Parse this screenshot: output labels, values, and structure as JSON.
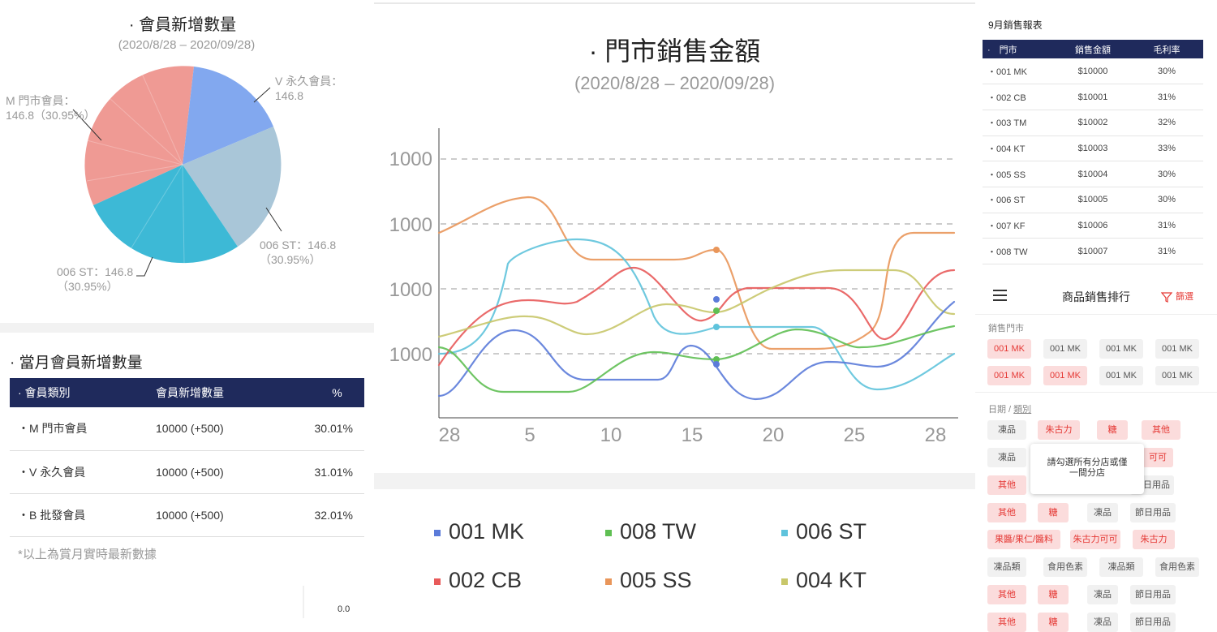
{
  "member_pie": {
    "title": "· 會員新增數量",
    "subtitle": "(2020/8/28 – 2020/09/28)",
    "labels": {
      "m": [
        "M 門市會員：",
        "146.8（30.95%）"
      ],
      "v": [
        "V 永久會員：",
        "146.8"
      ],
      "st1": [
        "006 ST：146.8",
        "（30.95%）"
      ],
      "st2": [
        "006 ST：146.8",
        "（30.95%）"
      ]
    },
    "colors": {
      "salmon": "#ef9a94",
      "blue": "#82a8ef",
      "grayblue": "#a9c6d8",
      "cyan": "#3db9d6"
    }
  },
  "monthly": {
    "title": "· 當月會員新增數量",
    "headers": [
      "· 會員類別",
      "會員新增數量",
      "%"
    ],
    "rows": [
      [
        "・M 門市會員",
        "10000 (+500)",
        "30.01%"
      ],
      [
        "・V 永久會員",
        "10000 (+500)",
        "31.01%"
      ],
      [
        "・B 批發會員",
        "10000 (+500)",
        "32.01%"
      ]
    ],
    "note": "*以上為賞月實時最新數據",
    "zero": "0.0"
  },
  "sales_chart": {
    "title": "· 門市銷售金額",
    "subtitle": "(2020/8/28 – 2020/09/28)",
    "y_tick_labels": [
      "1000",
      "1000",
      "1000",
      "1000"
    ],
    "x_tick_labels": [
      "28",
      "5",
      "10",
      "15",
      "20",
      "25",
      "28"
    ],
    "legend": [
      {
        "name": "001 MK",
        "color": "#5b7bd9"
      },
      {
        "name": "008 TW",
        "color": "#5fbf53"
      },
      {
        "name": "006 ST",
        "color": "#5fc3dc"
      },
      {
        "name": "002 CB",
        "color": "#e85a5a"
      },
      {
        "name": "005 SS",
        "color": "#e9965a"
      },
      {
        "name": "004 KT",
        "color": "#c8c76a"
      }
    ]
  },
  "sep_report": {
    "title": "9月銷售報表",
    "headers": [
      "·　門市",
      "銷售金額",
      "毛利率"
    ],
    "rows": [
      [
        "・001 MK",
        "$10000",
        "30%"
      ],
      [
        "・002 CB",
        "$10001",
        "31%"
      ],
      [
        "・003 TM",
        "$10002",
        "32%"
      ],
      [
        "・004 KT",
        "$10003",
        "33%"
      ],
      [
        "・005 SS",
        "$10004",
        "30%"
      ],
      [
        "・006 ST",
        "$10005",
        "30%"
      ],
      [
        "・007 KF",
        "$10006",
        "31%"
      ],
      [
        "・008 TW",
        "$10007",
        "31%"
      ]
    ]
  },
  "ranking": {
    "title": "商品銷售排行",
    "filter": "篩選",
    "store_label": "銷售門市",
    "store_chips": [
      {
        "t": "001 MK",
        "on": true
      },
      {
        "t": "001 MK",
        "on": false
      },
      {
        "t": "001 MK",
        "on": false
      },
      {
        "t": "001 MK",
        "on": false
      },
      {
        "t": "001 MK",
        "on": true
      },
      {
        "t": "001 MK",
        "on": true
      },
      {
        "t": "001 MK",
        "on": false
      },
      {
        "t": "001 MK",
        "on": false
      }
    ],
    "date_label": "日期 / ",
    "category_label": "類別",
    "cat_chips": [
      {
        "t": "凍品",
        "on": false
      },
      {
        "t": "朱古力",
        "on": true
      },
      {
        "t": "糖",
        "on": true
      },
      {
        "t": "其他",
        "on": true
      },
      {
        "t": "凍品",
        "on": false
      },
      {
        "t": "可可",
        "on": true
      },
      {
        "t": "其他",
        "on": true
      },
      {
        "t": "節日用品",
        "on": false
      },
      {
        "t": "其他",
        "on": true
      },
      {
        "t": "糖",
        "on": true
      },
      {
        "t": "凍品",
        "on": false
      },
      {
        "t": "節日用品",
        "on": false
      },
      {
        "t": "果醬/果仁/醬料",
        "on": true
      },
      {
        "t": "朱古力可可",
        "on": true
      },
      {
        "t": "朱古力",
        "on": true
      },
      {
        "t": "凍品類",
        "on": false
      },
      {
        "t": "食用色素",
        "on": false
      },
      {
        "t": "凍品類",
        "on": false
      },
      {
        "t": "食用色素",
        "on": false
      },
      {
        "t": "其他",
        "on": true
      },
      {
        "t": "糖",
        "on": true
      },
      {
        "t": "凍品",
        "on": false
      },
      {
        "t": "節日用品",
        "on": false
      },
      {
        "t": "其他",
        "on": true
      },
      {
        "t": "糖",
        "on": true
      },
      {
        "t": "凍品",
        "on": false
      },
      {
        "t": "節日用品",
        "on": false
      }
    ],
    "tooltip": [
      "請勾選所有分店或僅",
      "一間分店"
    ]
  }
}
